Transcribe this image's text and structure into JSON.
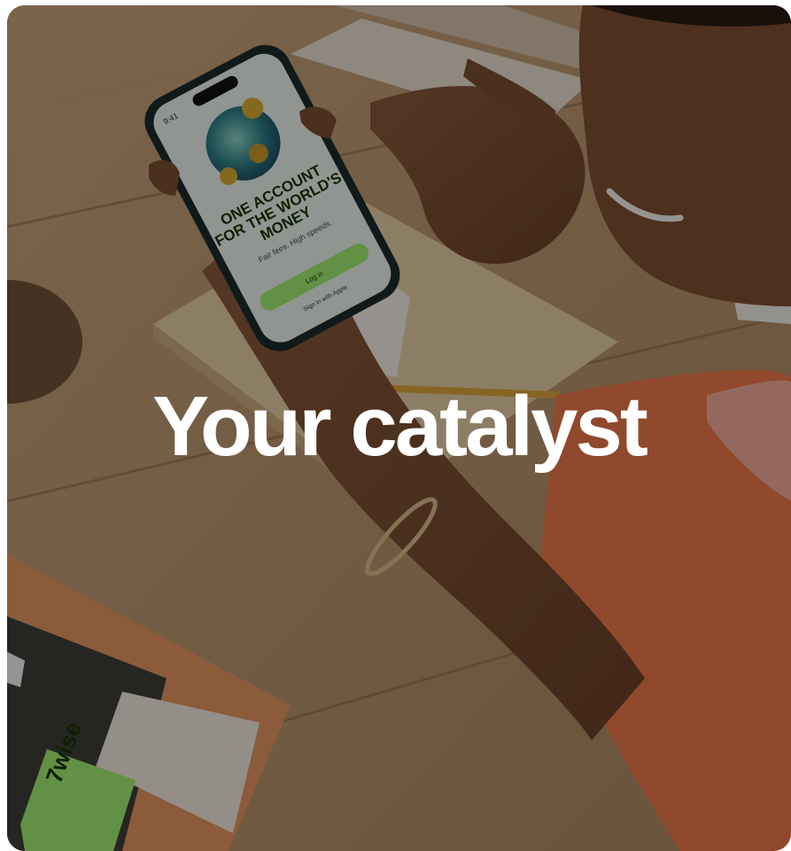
{
  "card": {
    "headline": "Your catalyst"
  },
  "phone_screen": {
    "time": "9:41",
    "heading_line1": "ONE ACCOUNT",
    "heading_line2": "FOR THE WORLD'S",
    "heading_line3": "MONEY",
    "tagline": "Fair fees. High speeds.",
    "login_button": "Log in",
    "apple_button": "Sign in with Apple"
  },
  "wise_card": {
    "brand": "7wise"
  },
  "colors": {
    "overlay": "#00000061",
    "wise_green": "#9fe870",
    "shirt": "#e9764a"
  }
}
